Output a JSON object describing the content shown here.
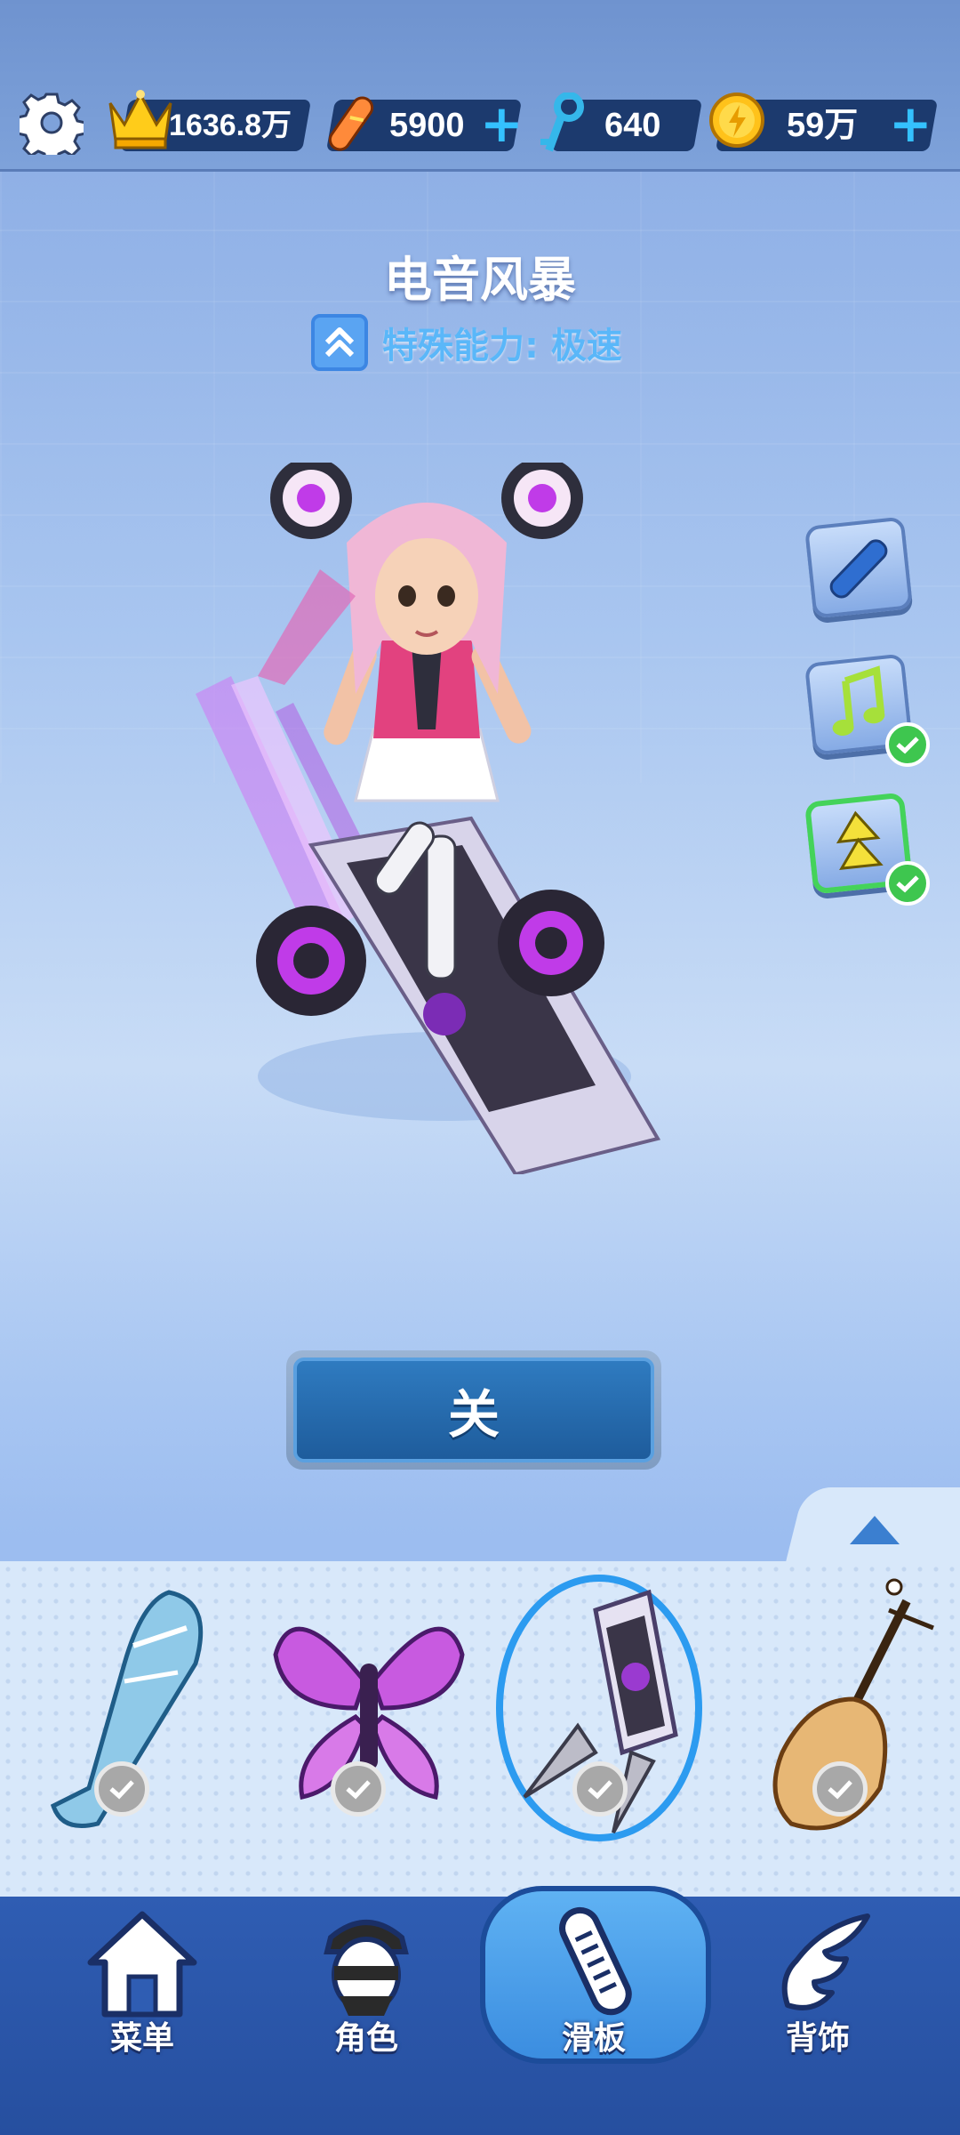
{
  "resources": {
    "trophies": "1636.8万",
    "hoverboards": "5900",
    "keys": "640",
    "coins": "59万"
  },
  "board": {
    "name": "电音风暴",
    "ability": "特殊能力: 极速"
  },
  "close_label": "关",
  "nav": {
    "menu": "菜单",
    "character": "角色",
    "board": "滑板",
    "accessory": "背饰"
  },
  "colors": {
    "accent": "#2c9bf0",
    "check_green": "#3ec64f",
    "resource_plus": "#34c1ff"
  }
}
